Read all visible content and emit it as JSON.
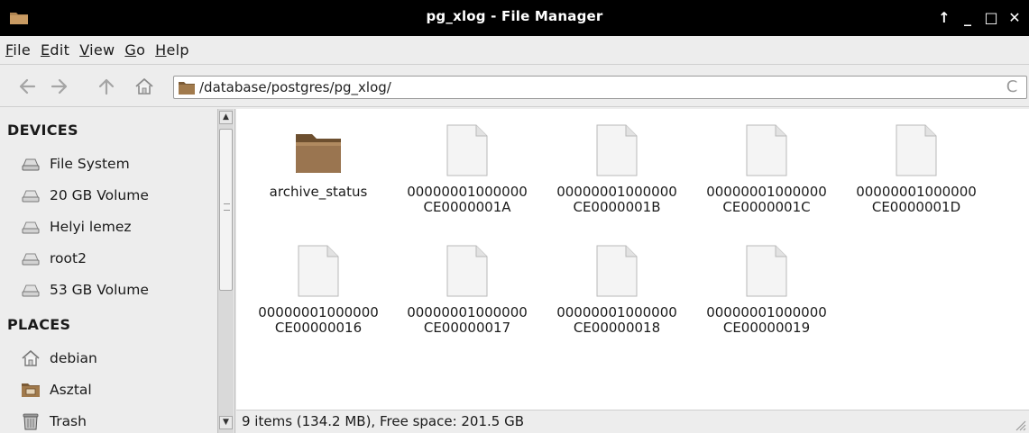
{
  "window": {
    "title": "pg_xlog - File Manager",
    "controls": [
      "↑",
      "_",
      "□",
      "✕"
    ]
  },
  "menu": [
    {
      "accel": "F",
      "rest": "ile"
    },
    {
      "accel": "E",
      "rest": "dit"
    },
    {
      "accel": "V",
      "rest": "iew"
    },
    {
      "accel": "G",
      "rest": "o"
    },
    {
      "accel": "H",
      "rest": "elp"
    }
  ],
  "toolbar": {
    "back_icon": "back-arrow-icon",
    "forward_icon": "forward-arrow-icon",
    "up_icon": "up-arrow-icon",
    "home_icon": "home-icon",
    "path": "/database/postgres/pg_xlog/",
    "reload_glyph": "C"
  },
  "sidebar": {
    "devices_heading": "DEVICES",
    "devices": [
      {
        "label": "File System",
        "icon": "drive-icon"
      },
      {
        "label": "20 GB Volume",
        "icon": "drive-icon"
      },
      {
        "label": "Helyi lemez",
        "icon": "drive-icon"
      },
      {
        "label": "root2",
        "icon": "drive-icon"
      },
      {
        "label": "53 GB Volume",
        "icon": "drive-icon"
      }
    ],
    "places_heading": "PLACES",
    "places": [
      {
        "label": "debian",
        "icon": "home-icon"
      },
      {
        "label": "Asztal",
        "icon": "desktop-folder-icon"
      },
      {
        "label": "Trash",
        "icon": "trash-icon"
      }
    ]
  },
  "files": [
    {
      "line1": "archive_status",
      "line2": "",
      "type": "folder"
    },
    {
      "line1": "00000001000000",
      "line2": "CE0000001A",
      "type": "file"
    },
    {
      "line1": "00000001000000",
      "line2": "CE0000001B",
      "type": "file"
    },
    {
      "line1": "00000001000000",
      "line2": "CE0000001C",
      "type": "file"
    },
    {
      "line1": "00000001000000",
      "line2": "CE0000001D",
      "type": "file"
    },
    {
      "line1": "00000001000000",
      "line2": "CE00000016",
      "type": "file"
    },
    {
      "line1": "00000001000000",
      "line2": "CE00000017",
      "type": "file"
    },
    {
      "line1": "00000001000000",
      "line2": "CE00000018",
      "type": "file"
    },
    {
      "line1": "00000001000000",
      "line2": "CE00000019",
      "type": "file"
    }
  ],
  "status": {
    "text": "9 items (134.2 MB), Free space: 201.5 GB"
  },
  "colors": {
    "titlebar_bg": "#000000",
    "folder_brown": "#8b6a43",
    "window_bg": "#ededed"
  }
}
